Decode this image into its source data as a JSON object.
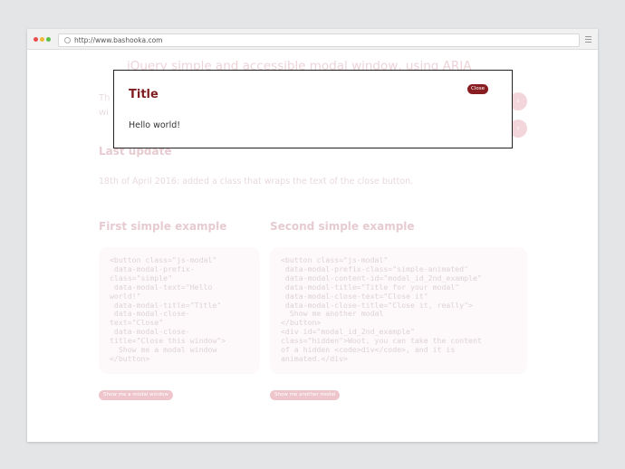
{
  "browser": {
    "url": "http://www.bashooka.com"
  },
  "page": {
    "title": "jQuery simple and accessible modal window, using ARIA",
    "intro_fragments": [
      "Th",
      "wi"
    ],
    "last_update_heading": "Last update",
    "last_update_text": "18th of April 2016: added a class that wraps the text of the close button.",
    "first_heading": "First simple example",
    "second_heading": "Second simple example",
    "code1": "<button class=\"js-modal\"\n data-modal-prefix-\nclass=\"simple\"\n data-modal-text=\"Hello\nworld!\"\n data-modal-title=\"Title\"\n data-modal-close-\ntext=\"Close\"\n data-modal-close-\ntitle=\"Close this window\">\n  Show me a modal window\n</button>",
    "code2": "<button class=\"js-modal\"\n data-modal-prefix-class=\"simple-animated\"\n data-modal-content-id=\"modal_id_2nd_example\"\n data-modal-title=\"Title for your modal\"\n data-modal-close-text=\"Close it\"\n data-modal-close-title=\"Close it, really\">\n  Show me another modal\n</button>\n<div id=\"modal_id_2nd_example\"\nclass=\"hidden\">Woot, you can take the content\nof a hidden <code>div</code>, and it is\nanimated.</div>",
    "button1_label": "Show me a modal window",
    "button2_label": "Show me another modal"
  },
  "modal": {
    "title": "Title",
    "close_label": "Close",
    "body": "Hello world!"
  },
  "colors": {
    "modal_accent": "#881e22",
    "faded_pink": "#efc5cc"
  }
}
